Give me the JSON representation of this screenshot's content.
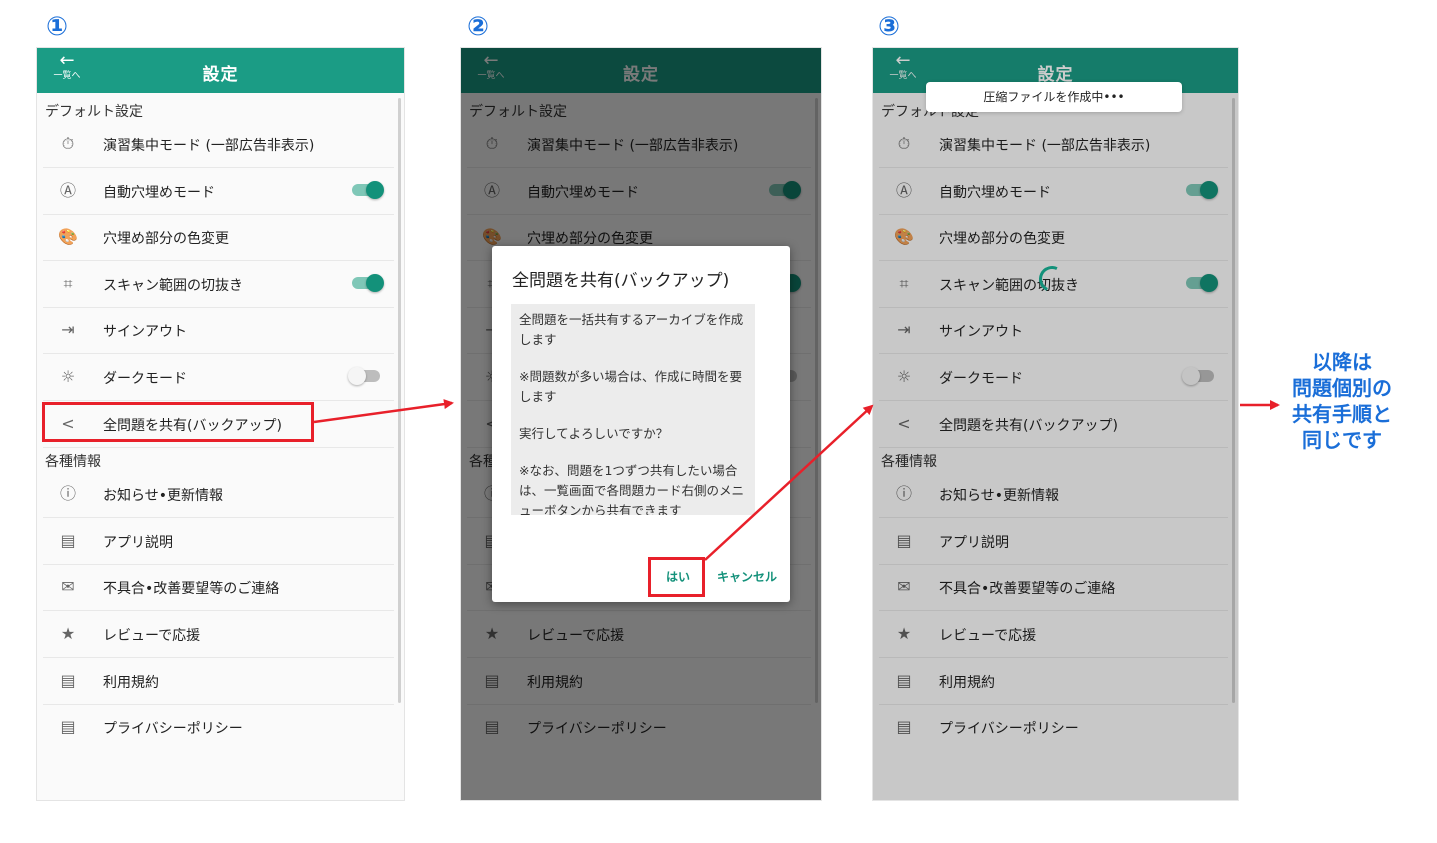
{
  "steps": [
    "①",
    "②",
    "③"
  ],
  "app": {
    "title": "設定",
    "back_label": "一覧へ",
    "back_icon": "←"
  },
  "sections": {
    "default_settings": "デフォルト設定",
    "info": "各種情報"
  },
  "settings_items": [
    {
      "label": "演習集中モード (一部広告非表示)",
      "icon": "stopwatch-icon",
      "glyph": "⏱",
      "toggle": null
    },
    {
      "label": "自動穴埋めモード",
      "icon": "auto-icon",
      "glyph": "Ⓐ",
      "toggle": true
    },
    {
      "label": "穴埋め部分の色変更",
      "icon": "palette-icon",
      "glyph": "🎨",
      "toggle": null
    },
    {
      "label": "スキャン範囲の切抜き",
      "icon": "crop-icon",
      "glyph": "⌗",
      "toggle": true
    },
    {
      "label": "サインアウト",
      "icon": "sign-out-icon",
      "glyph": "⇥",
      "toggle": null
    },
    {
      "label": "ダークモード",
      "icon": "sun-icon",
      "glyph": "☼",
      "toggle": false
    },
    {
      "label": "全問題を共有(バックアップ)",
      "icon": "share-icon",
      "glyph": "<",
      "toggle": null
    }
  ],
  "info_items": [
    {
      "label": "お知らせ•更新情報",
      "icon": "info-icon",
      "glyph": "ⓘ"
    },
    {
      "label": "アプリ説明",
      "icon": "document-icon",
      "glyph": "▤"
    },
    {
      "label": "不具合•改善要望等のご連絡",
      "icon": "mail-icon",
      "glyph": "✉"
    },
    {
      "label": "レビューで応援",
      "icon": "star-icon",
      "glyph": "★"
    },
    {
      "label": "利用規約",
      "icon": "document-icon",
      "glyph": "▤"
    },
    {
      "label": "プライバシーポリシー",
      "icon": "document-icon",
      "glyph": "▤"
    }
  ],
  "dialog": {
    "title": "全問題を共有(バックアップ)",
    "paragraphs": [
      "全問題を一括共有するアーカイブを作成します",
      "※問題数が多い場合は、作成に時間を要します",
      "実行してよろしいですか？",
      "※なお、問題を1つずつ共有したい場合は、一覧画面で各問題カード右側のメニューボタンから共有できます"
    ],
    "yes": "はい",
    "cancel": "キャンセル"
  },
  "toast": "圧縮ファイルを作成中•••",
  "note_lines": [
    "以降は",
    "問題個別の",
    "共有手順と",
    "同じです"
  ],
  "colors": {
    "appbar": "#1b9c85",
    "accent": "#13917a",
    "highlight": "#e8202a",
    "step_blue": "#1a6ed8"
  }
}
